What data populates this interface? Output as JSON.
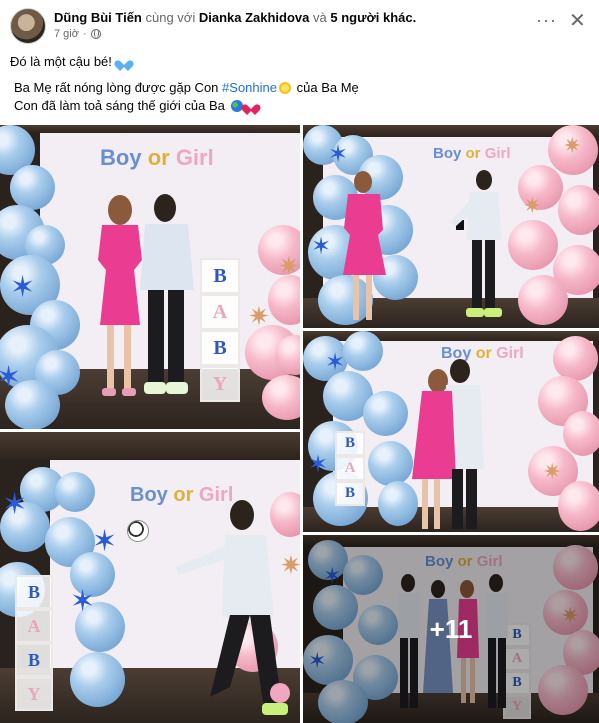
{
  "post": {
    "author": "Dũng Bùi Tiến",
    "with_text": "cùng với",
    "tagged_person": "Dianka Zakhidova",
    "and_text": "và",
    "others": "5 người khác.",
    "time": "7 giờ",
    "dot": "·"
  },
  "caption": {
    "line1": "Đó là một cậu bé!",
    "line2_before": "Ba Mẹ rất nóng lòng được gặp Con",
    "hashtag": "#Sonhine",
    "line2_after": "của Ba Mẹ",
    "line3": "Con đã làm toả sáng thế giới của Ba"
  },
  "backdrop_text": {
    "boy": "Boy",
    "or": "or",
    "girl": "Girl"
  },
  "letter_boxes": [
    "B",
    "A",
    "B",
    "Y"
  ],
  "gallery": {
    "more_count": "+11"
  },
  "colors": {
    "link_blue": "#216fdb",
    "secondary_text": "#65676b"
  },
  "icons": [
    "avatar",
    "globe-icon",
    "more-icon",
    "close-icon",
    "blue-heart-icon",
    "sun-icon",
    "earth-icon",
    "red-heart-icon"
  ]
}
